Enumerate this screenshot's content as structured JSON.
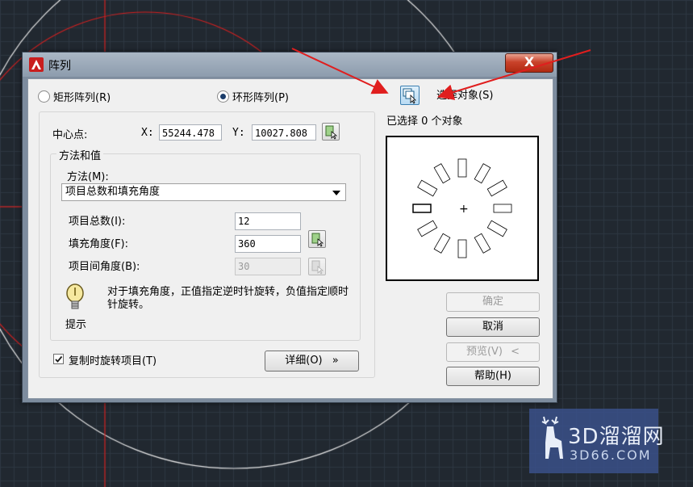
{
  "dialog": {
    "title": "阵列",
    "close_label": "X",
    "array_type": {
      "rect_label": "矩形阵列(R)",
      "polar_label": "环形阵列(P)",
      "selected": "polar"
    },
    "center": {
      "label": "中心点:",
      "x_label": "X:",
      "x_value": "55244.478",
      "y_label": "Y:",
      "y_value": "10027.808"
    },
    "method_group": {
      "title": "方法和值",
      "method_label": "方法(M):",
      "method_value": "项目总数和填充角度",
      "total_label": "项目总数(I):",
      "total_value": "12",
      "fill_label": "填充角度(F):",
      "fill_value": "360",
      "between_label": "项目间角度(B):",
      "between_value": "30",
      "tip_text": "对于填充角度，正值指定逆时针旋转，负值指定顺时针旋转。",
      "tip_label": "提示"
    },
    "rotate_checkbox": {
      "label": "复制时旋转项目(T)",
      "checked": true
    },
    "details_button": "详细(O)",
    "details_icon": "»",
    "select_objects_label": "选择对象(S)",
    "selected_count_text": "已选择 0 个对象",
    "buttons": {
      "ok": "确定",
      "cancel": "取消",
      "preview": "预览(V)",
      "preview_icon": "<",
      "help": "帮助(H)"
    },
    "preview": {
      "item_count": 12
    }
  },
  "watermark": {
    "main": "3D溜溜网",
    "sub": "3D66.COM"
  },
  "colors": {
    "cad_background": "#212830",
    "grid_line": "#2e3742",
    "annotation_arrow": "#e01e1e",
    "circle_white": "#e6e6e6",
    "circle_red": "#d42020",
    "watermark_bg": "#3a528c"
  }
}
